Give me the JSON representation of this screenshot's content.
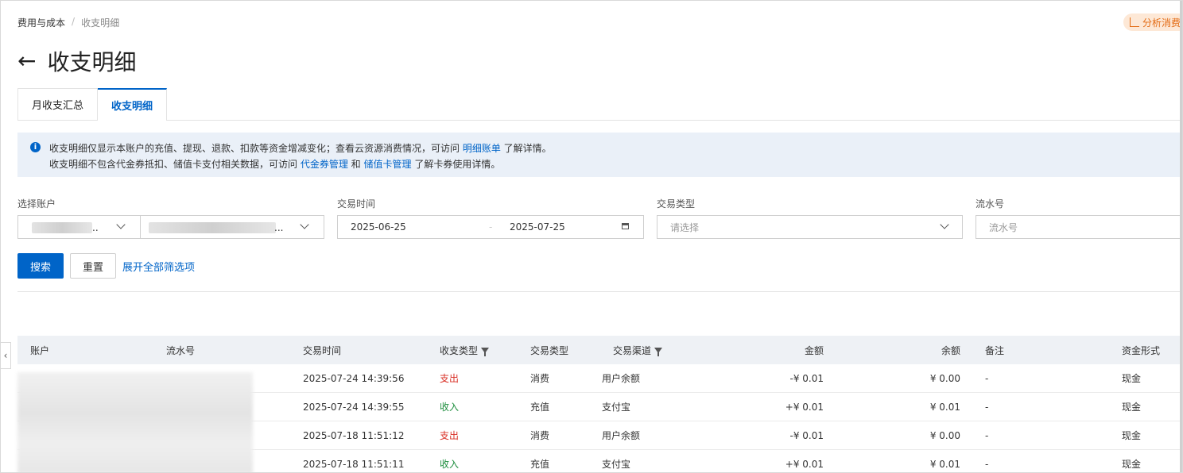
{
  "breadcrumb": {
    "parent": "费用与成本",
    "separator": "/",
    "current": "收支明细"
  },
  "analyze_button": {
    "label": "分析消费"
  },
  "page_title": "收支明细",
  "tabs": [
    {
      "label": "月收支汇总",
      "active": false
    },
    {
      "label": "收支明细",
      "active": true
    }
  ],
  "notice": {
    "line1_text": "收支明细仅显示本账户的充值、提现、退款、扣款等资金增减变化；查看云资源消费情况，可访问 ",
    "line1_link": "明细账单",
    "line1_suffix": " 了解详情。",
    "line2_text": "收支明细不包含代金券抵扣、储值卡支付相关数据，可访问 ",
    "line2_link1": "代金券管理",
    "line2_mid": " 和 ",
    "line2_link2": "储值卡管理",
    "line2_suffix": " 了解卡券使用详情。"
  },
  "filters": {
    "account": {
      "label": "选择账户",
      "value1_suffix": "..",
      "value2_suffix": "..."
    },
    "time": {
      "label": "交易时间",
      "start": "2025-06-25",
      "separator": "-",
      "end": "2025-07-25"
    },
    "type": {
      "label": "交易类型",
      "placeholder": "请选择"
    },
    "serial": {
      "label": "流水号",
      "placeholder": "流水号"
    }
  },
  "buttons": {
    "search": "搜索",
    "reset": "重置",
    "expand": "展开全部筛选项"
  },
  "table": {
    "headers": {
      "account": "账户",
      "serial": "流水号",
      "time": "交易时间",
      "direction": "收支类型",
      "type": "交易类型",
      "channel": "交易渠道",
      "amount": "金额",
      "balance": "余额",
      "remark": "备注",
      "fund": "资金形式"
    },
    "rows": [
      {
        "time": "2025-07-24 14:39:56",
        "direction": "支出",
        "type": "消费",
        "channel": "用户余额",
        "amount": "-¥ 0.01",
        "balance": "¥ 0.00",
        "remark": "-",
        "fund": "现金"
      },
      {
        "time": "2025-07-24 14:39:55",
        "direction": "收入",
        "type": "充值",
        "channel": "支付宝",
        "amount": "+¥ 0.01",
        "balance": "¥ 0.01",
        "remark": "-",
        "fund": "现金"
      },
      {
        "time": "2025-07-18 11:51:12",
        "direction": "支出",
        "type": "消费",
        "channel": "用户余额",
        "amount": "-¥ 0.01",
        "balance": "¥ 0.00",
        "remark": "-",
        "fund": "现金"
      },
      {
        "time": "2025-07-18 11:51:11",
        "direction": "收入",
        "type": "充值",
        "channel": "支付宝",
        "amount": "+¥ 0.01",
        "balance": "¥ 0.01",
        "remark": "-",
        "fund": "现金"
      }
    ]
  },
  "colors": {
    "primary": "#0064c8",
    "expense": "#d93026",
    "income": "#1e8e3e",
    "accent_orange": "#e36a12"
  },
  "icons": {
    "back": "arrow-left-icon",
    "info": "info-icon",
    "calendar": "calendar-icon",
    "chevron": "chevron-down-icon",
    "filter": "filter-icon",
    "analyze": "chart-icon",
    "collapse": "chevron-left-icon"
  }
}
